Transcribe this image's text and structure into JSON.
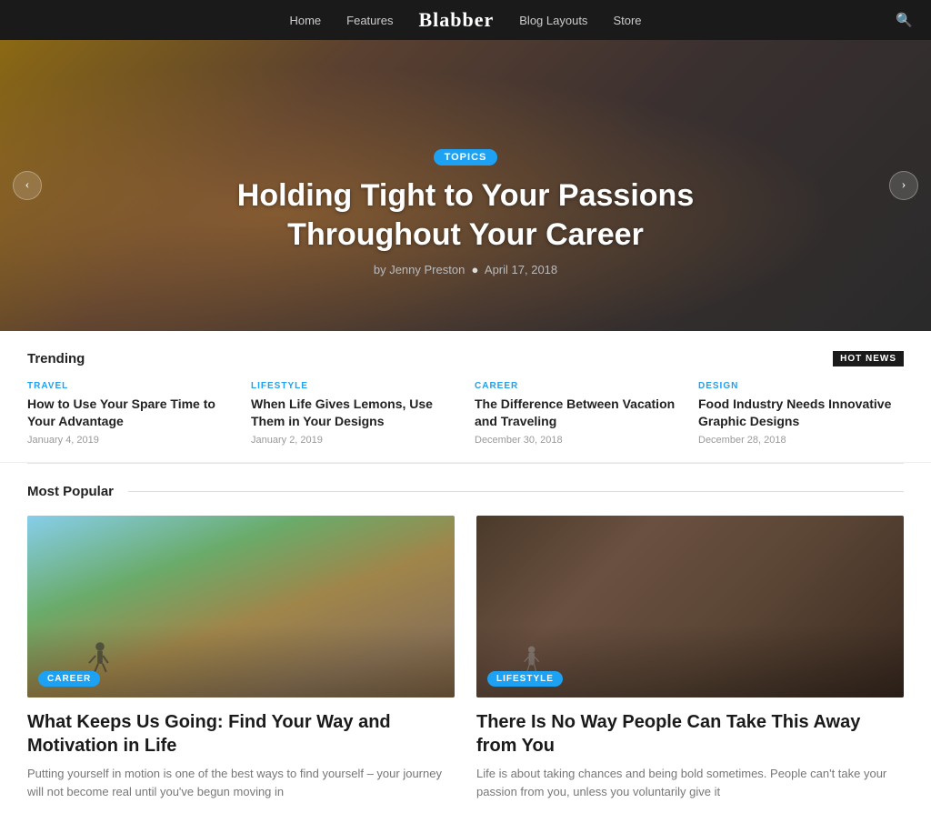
{
  "nav": {
    "links": [
      "Home",
      "Features",
      "Blog Layouts",
      "Store"
    ],
    "logo": "Blabber",
    "search_label": "search"
  },
  "hero": {
    "badge": "TOPICS",
    "title": "Holding Tight to Your Passions Throughout Your Career",
    "author": "by Jenny Preston",
    "date": "April 17, 2018",
    "prev_label": "‹",
    "next_label": "›"
  },
  "trending": {
    "section_title": "Trending",
    "hot_news_label": "HOT NEWS",
    "items": [
      {
        "category": "TRAVEL",
        "title": "How to Use Your Spare Time to Your Advantage",
        "date": "January 4, 2019"
      },
      {
        "category": "LIFESTYLE",
        "title": "When Life Gives Lemons, Use Them in Your Designs",
        "date": "January 2, 2019"
      },
      {
        "category": "CAREER",
        "title": "The Difference Between Vacation and Traveling",
        "date": "December 30, 2018"
      },
      {
        "category": "DESIGN",
        "title": "Food Industry Needs Innovative Graphic Designs",
        "date": "December 28, 2018"
      }
    ]
  },
  "popular": {
    "section_title": "Most Popular",
    "cards": [
      {
        "badge": "CAREER",
        "title": "What Keeps Us Going: Find Your Way and Motivation in Life",
        "excerpt": "Putting yourself in motion is one of the best ways to find yourself – your journey will not become real until you've begun moving in"
      },
      {
        "badge": "LIFESTYLE",
        "title": "There Is No Way People Can Take This Away from You",
        "excerpt": "Life is about taking chances and being bold sometimes. People can't take your passion from you, unless you voluntarily give it"
      }
    ]
  }
}
